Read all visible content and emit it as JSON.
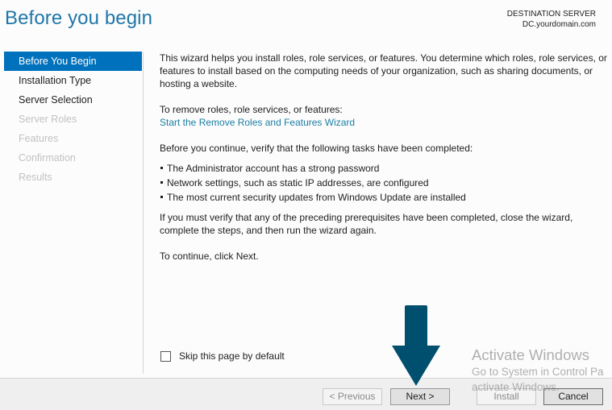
{
  "header": {
    "title": "Before you begin",
    "destination_label": "DESTINATION SERVER",
    "destination_server": "DC.yourdomain.com"
  },
  "sidebar": {
    "items": [
      {
        "label": "Before You Begin",
        "state": "active"
      },
      {
        "label": "Installation Type",
        "state": "enabled"
      },
      {
        "label": "Server Selection",
        "state": "enabled"
      },
      {
        "label": "Server Roles",
        "state": "disabled"
      },
      {
        "label": "Features",
        "state": "disabled"
      },
      {
        "label": "Confirmation",
        "state": "disabled"
      },
      {
        "label": "Results",
        "state": "disabled"
      }
    ]
  },
  "content": {
    "intro": "This wizard helps you install roles, role services, or features. You determine which roles, role services, or features to install based on the computing needs of your organization, such as sharing documents, or hosting a website.",
    "remove_label": "To remove roles, role services, or features:",
    "remove_link": "Start the Remove Roles and Features Wizard",
    "verify_intro": "Before you continue, verify that the following tasks have been completed:",
    "tasks": [
      "The Administrator account has a strong password",
      "Network settings, such as static IP addresses, are configured",
      "The most current security updates from Windows Update are installed"
    ],
    "if_verify": "If you must verify that any of the preceding prerequisites have been completed, close the wizard, complete the steps, and then run the wizard again.",
    "continue": "To continue, click Next."
  },
  "skip_checkbox": {
    "label": "Skip this page by default",
    "checked": false
  },
  "buttons": {
    "previous": "< Previous",
    "next": "Next >",
    "install": "Install",
    "cancel": "Cancel"
  },
  "watermark": {
    "title": "Activate Windows",
    "line1": "Go to System in Control Pa",
    "line2": "activate Windows."
  },
  "annotation": {
    "type": "down-arrow",
    "target": "next-button",
    "color": "#004f6e"
  },
  "colors": {
    "title": "#1f77a8",
    "active_nav": "#0071bc",
    "link": "#1a7ea3",
    "disabled_text": "#c2c2c2",
    "footer_bg": "#efefef"
  }
}
